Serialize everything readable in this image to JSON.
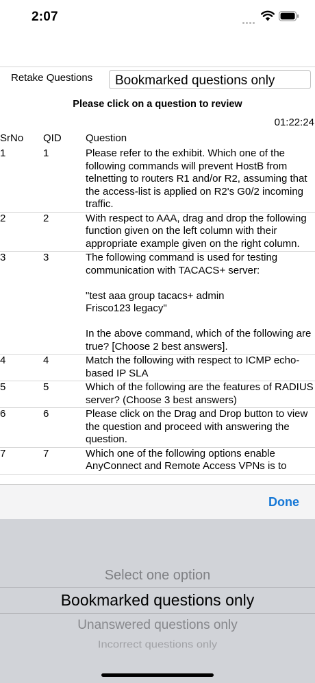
{
  "status_bar": {
    "time": "2:07"
  },
  "filter": {
    "label": "Retake Questions",
    "selected": "Bookmarked questions only"
  },
  "instruction": "Please click on a question to review",
  "timer": "01:22:24",
  "table": {
    "headers": {
      "srno": "SrNo",
      "qid": "QID",
      "question": "Question"
    },
    "rows": [
      {
        "srno": "1",
        "qid": "1",
        "question": "Please refer to the exhibit. Which one of the following commands will prevent HostB from telnetting to routers R1 and/or R2, assuming that the access-list is applied on R2's G0/2 incoming traffic."
      },
      {
        "srno": "2",
        "qid": "2",
        "question": "With respect to AAA, drag and drop the following function given on the left column with their appropriate example given on the right column."
      },
      {
        "srno": "3",
        "qid": "3",
        "question": "The following command is used for testing communication with TACACS+ server:\n\n\"test aaa group tacacs+ admin\nFrisco123 legacy\"\n\nIn the above command, which of the following are true? [Choose 2 best answers]."
      },
      {
        "srno": "4",
        "qid": "4",
        "question": "Match the following with respect to ICMP echo-based IP SLA"
      },
      {
        "srno": "5",
        "qid": "5",
        "question": "Which of the following are the features of RADIUS server? (Choose 3 best answers)"
      },
      {
        "srno": "6",
        "qid": "6",
        "question": "Please click on the Drag and Drop button to view the question and proceed with answering the question."
      },
      {
        "srno": "7",
        "qid": "7",
        "question": "Which one of the following options enable AnyConnect and Remote Access VPNs is to"
      }
    ]
  },
  "picker": {
    "done_label": "Done",
    "options": [
      "Select one option",
      "Bookmarked questions only",
      "Unanswered questions only",
      "Incorrect questions only"
    ],
    "selected_index": 1
  },
  "colors": {
    "accent": "#1577d6",
    "picker_background": "#d1d3d8",
    "toolbar_background": "#f4f4f5"
  }
}
